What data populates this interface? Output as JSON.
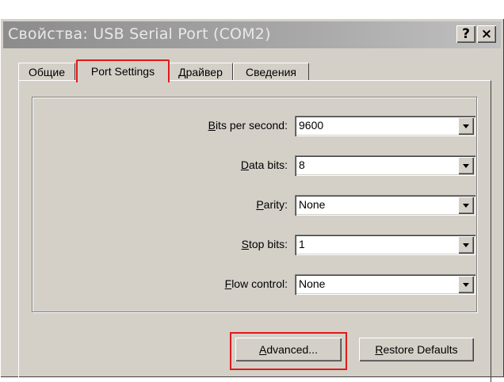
{
  "window": {
    "title": "Свойства: USB Serial Port (COM2)",
    "help_label": "?",
    "close_label": "×"
  },
  "tabs": [
    {
      "label": "Общие"
    },
    {
      "label": "Port Settings",
      "selected": true
    },
    {
      "label": "Драйвер"
    },
    {
      "label": "Сведения"
    }
  ],
  "settings": [
    {
      "key": "bits_per_second",
      "mnemonic": "B",
      "label_rest": "its per second:",
      "value": "9600"
    },
    {
      "key": "data_bits",
      "mnemonic": "D",
      "label_rest": "ata bits:",
      "value": "8"
    },
    {
      "key": "parity",
      "mnemonic": "P",
      "label_rest": "arity:",
      "value": "None"
    },
    {
      "key": "stop_bits",
      "mnemonic": "S",
      "label_rest": "top bits:",
      "value": "1"
    },
    {
      "key": "flow_control",
      "mnemonic": "F",
      "label_rest": "low control:",
      "value": "None"
    }
  ],
  "buttons": {
    "advanced_mnemonic": "A",
    "advanced_rest": "dvanced...",
    "restore_mnemonic": "R",
    "restore_rest": "estore Defaults"
  },
  "colors": {
    "dialog_face": "#d4d0c8",
    "highlight_box": "#e01a1a",
    "inactive_title": "#8c8c8c"
  }
}
